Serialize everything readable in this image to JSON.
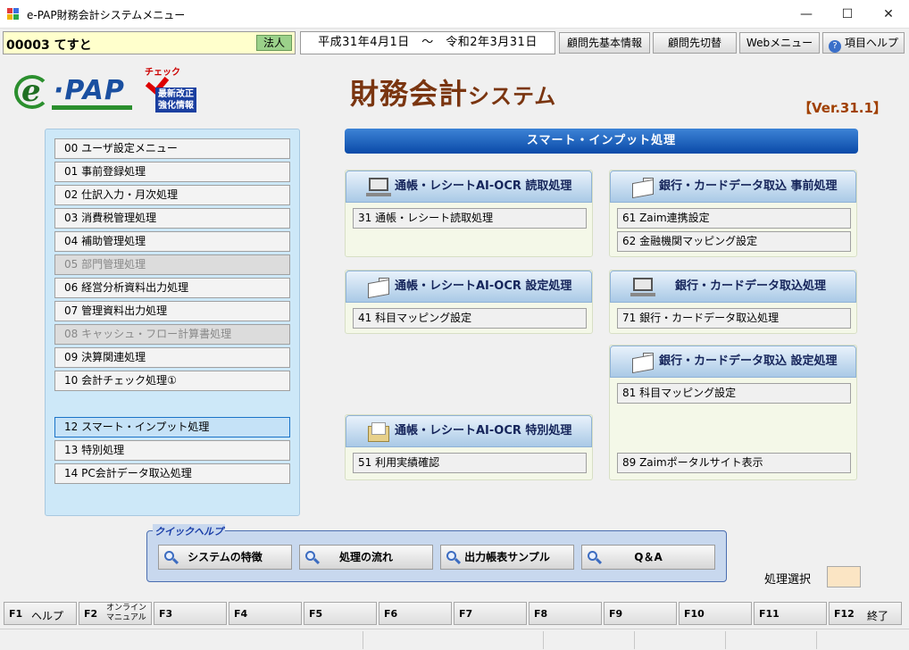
{
  "window": {
    "title": "e-PAP財務会計システムメニュー"
  },
  "topbar": {
    "company": "00003 てすと",
    "company_type": "法人",
    "period": "平成31年4月1日　～　令和2年3月31日",
    "buttons": [
      "顧問先基本情報",
      "顧問先切替",
      "Webメニュー",
      "項目ヘルプ"
    ]
  },
  "header": {
    "check_label": "チェック",
    "check_box": [
      "最新改正",
      "強化情報"
    ],
    "title_main": "財務会計",
    "title_sub": "システム",
    "version": "【Ver.31.1】"
  },
  "left_menu": [
    {
      "label": "00 ユーザ設定メニュー",
      "state": "normal"
    },
    {
      "label": "01 事前登録処理",
      "state": "normal"
    },
    {
      "label": "02 仕訳入力・月次処理",
      "state": "normal"
    },
    {
      "label": "03 消費税管理処理",
      "state": "normal"
    },
    {
      "label": "04 補助管理処理",
      "state": "normal"
    },
    {
      "label": "05 部門管理処理",
      "state": "disabled"
    },
    {
      "label": "06 経営分析資料出力処理",
      "state": "normal"
    },
    {
      "label": "07 管理資料出力処理",
      "state": "normal"
    },
    {
      "label": "08 キャッシュ・フロー計算書処理",
      "state": "disabled"
    },
    {
      "label": "09 決算関連処理",
      "state": "normal"
    },
    {
      "label": "10 会計チェック処理①",
      "state": "normal"
    },
    {
      "label": "12 スマート・インプット処理",
      "state": "selected"
    },
    {
      "label": "13 特別処理",
      "state": "normal"
    },
    {
      "label": "14 PC会計データ取込処理",
      "state": "normal"
    }
  ],
  "main": {
    "heading": "スマート・インプット処理",
    "sections": [
      {
        "title": "通帳・レシートAI-OCR 読取処理",
        "icon": "monitor-icon",
        "items": [
          "31 通帳・レシート読取処理"
        ]
      },
      {
        "title": "通帳・レシートAI-OCR 設定処理",
        "icon": "card-icon",
        "items": [
          "41 科目マッピング設定"
        ]
      },
      {
        "title": "通帳・レシートAI-OCR 特別処理",
        "icon": "folder-icon",
        "items": [
          "51 利用実績確認"
        ]
      },
      {
        "title": "銀行・カードデータ取込 事前処理",
        "icon": "card-icon",
        "items": [
          "61 Zaim連携設定",
          "62 金融機関マッピング設定"
        ]
      },
      {
        "title": "銀行・カードデータ取込処理",
        "icon": "monitor-icon",
        "items": [
          "71 銀行・カードデータ取込処理"
        ]
      },
      {
        "title": "銀行・カードデータ取込 設定処理",
        "icon": "card-icon",
        "items": [
          "81 科目マッピング設定",
          "89 Zaimポータルサイト表示"
        ]
      }
    ]
  },
  "quick_help": {
    "legend": "クイックヘルプ",
    "buttons": [
      "システムの特徴",
      "処理の流れ",
      "出力帳表サンプル",
      "Q＆A"
    ]
  },
  "selection": {
    "label": "処理選択",
    "value": ""
  },
  "function_keys": [
    {
      "key": "F1",
      "label": "ヘルプ"
    },
    {
      "key": "F2",
      "label": "オンライン\nマニュアル"
    },
    {
      "key": "F3",
      "label": ""
    },
    {
      "key": "F4",
      "label": ""
    },
    {
      "key": "F5",
      "label": ""
    },
    {
      "key": "F6",
      "label": ""
    },
    {
      "key": "F7",
      "label": ""
    },
    {
      "key": "F8",
      "label": ""
    },
    {
      "key": "F9",
      "label": ""
    },
    {
      "key": "F10",
      "label": ""
    },
    {
      "key": "F11",
      "label": ""
    },
    {
      "key": "F12",
      "label": "終了"
    }
  ]
}
